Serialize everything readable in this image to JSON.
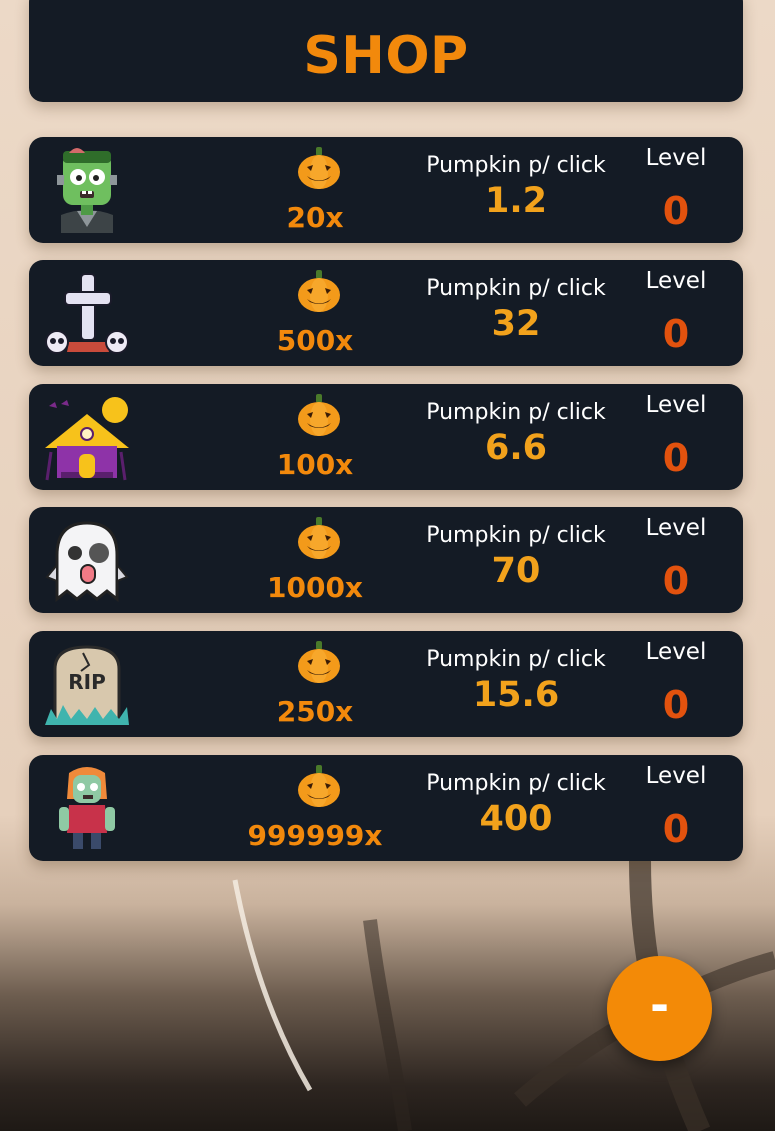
{
  "header": {
    "title": "SHOP"
  },
  "item_labels": {
    "ppc": "Pumpkin p/ click",
    "level": "Level"
  },
  "items": [
    {
      "icon": "zombie-frankenstein-icon",
      "cost": "20x",
      "ppc": "1.2",
      "level": "0"
    },
    {
      "icon": "grave-cross-skulls-icon",
      "cost": "500x",
      "ppc": "32",
      "level": "0"
    },
    {
      "icon": "haunted-house-icon",
      "cost": "100x",
      "ppc": "6.6",
      "level": "0"
    },
    {
      "icon": "ghost-icon",
      "cost": "1000x",
      "ppc": "70",
      "level": "0"
    },
    {
      "icon": "rip-tombstone-icon",
      "cost": "250x",
      "ppc": "15.6",
      "level": "0"
    },
    {
      "icon": "zombie-walker-icon",
      "cost": "999999x",
      "ppc": "400",
      "level": "0"
    }
  ],
  "fab": {
    "label": "-",
    "icon": "minus-icon"
  },
  "colors": {
    "panel": "#141b25",
    "accent": "#f2890c",
    "level": "#e2520e",
    "background": "#ead6c3"
  }
}
